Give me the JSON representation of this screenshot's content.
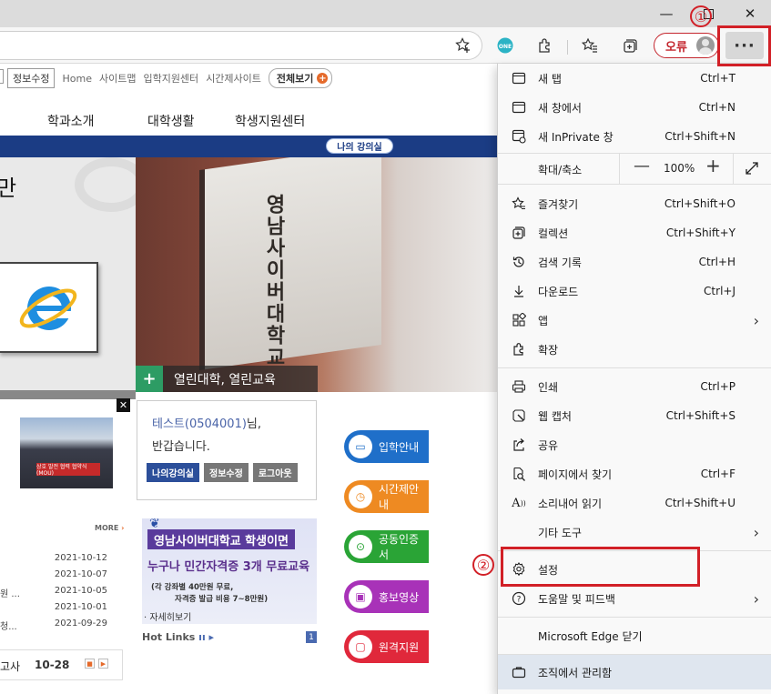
{
  "titlebar": {
    "minimize_icon": "minimize-icon",
    "maximize_icon": "maximize-icon",
    "close_icon": "close-icon"
  },
  "toolbar": {
    "error_label": "오류",
    "more_label": "···"
  },
  "annotations": {
    "marker1": "①",
    "marker2": "②",
    "highlight_color": "#d22027"
  },
  "page": {
    "top_links": {
      "profile_edit": "정보수정",
      "home": "Home",
      "sitemap": "사이트맵",
      "admission_center": "입학지원센터",
      "timetable_site": "시간제사이트",
      "view_all": "전체보기"
    },
    "gnb": [
      "학과소개",
      "대학생활",
      "학생지원센터"
    ],
    "my_lecture_badge": "나의 강의실",
    "hero_left_char": "만",
    "hero_sign_text": "영남사이버대학교",
    "hero_caption": "열린대학, 열린교육",
    "login_box": {
      "user": "테스트(0504001)",
      "greeting_suffix": "님,",
      "greeting_line2": "반갑습니다.",
      "buttons": [
        "나의강의실",
        "정보수정",
        "로그아웃"
      ]
    },
    "quick_menu": [
      {
        "label": "입학안내",
        "color": "#1f6fc9"
      },
      {
        "label": "시간제안내",
        "color": "#ee8a22"
      },
      {
        "label": "공동인증서",
        "color": "#2aa436"
      },
      {
        "label": "홍보영상",
        "color": "#a832b8"
      },
      {
        "label": "원격지원",
        "color": "#e0283b"
      }
    ],
    "ad_banner": {
      "line1": "영남사이버대학교 학생이면",
      "line2": "누구나 민간자격증 3개 무료교육",
      "line3": "(각 강좌별 40만원 무료,",
      "line4": "자격증 발급 비용 7~8만원)",
      "more": "· 자세히보기"
    },
    "hot_links": "Hot Links",
    "hot_links_page": "1",
    "more_label": "MORE",
    "news": [
      {
        "title": "",
        "date": "2021-10-12"
      },
      {
        "title": "",
        "date": "2021-10-07"
      },
      {
        "title": "원 ...",
        "date": "2021-10-05"
      },
      {
        "title": "",
        "date": "2021-10-01"
      },
      {
        "title": "청...",
        "date": "2021-09-29"
      }
    ],
    "exam_label": "고사",
    "exam_date": "10-28",
    "thumb_banner": "상호 발전 협력 협약식(MOU)"
  },
  "menu": {
    "items": [
      {
        "name": "new-tab",
        "icon": "new-tab-icon",
        "label": "새 탭",
        "shortcut": "Ctrl+T"
      },
      {
        "name": "new-window",
        "icon": "new-window-icon",
        "label": "새 창에서",
        "shortcut": "Ctrl+N"
      },
      {
        "name": "new-inprivate",
        "icon": "inprivate-icon",
        "label": "새 InPrivate 창",
        "shortcut": "Ctrl+Shift+N"
      },
      {
        "name": "favorites",
        "icon": "favorites-icon",
        "label": "즐겨찾기",
        "shortcut": "Ctrl+Shift+O"
      },
      {
        "name": "collections",
        "icon": "collections-icon",
        "label": "컬렉션",
        "shortcut": "Ctrl+Shift+Y"
      },
      {
        "name": "history",
        "icon": "history-icon",
        "label": "검색 기록",
        "shortcut": "Ctrl+H"
      },
      {
        "name": "downloads",
        "icon": "download-icon",
        "label": "다운로드",
        "shortcut": "Ctrl+J"
      },
      {
        "name": "apps",
        "icon": "apps-icon",
        "label": "앱",
        "shortcut": ""
      },
      {
        "name": "extensions",
        "icon": "extensions-icon",
        "label": "확장",
        "shortcut": ""
      },
      {
        "name": "print",
        "icon": "print-icon",
        "label": "인쇄",
        "shortcut": "Ctrl+P"
      },
      {
        "name": "web-capture",
        "icon": "web-capture-icon",
        "label": "웹 캡처",
        "shortcut": "Ctrl+Shift+S"
      },
      {
        "name": "share",
        "icon": "share-icon",
        "label": "공유",
        "shortcut": ""
      },
      {
        "name": "find",
        "icon": "find-icon",
        "label": "페이지에서 찾기",
        "shortcut": "Ctrl+F"
      },
      {
        "name": "read-aloud",
        "icon": "read-aloud-icon",
        "label": "소리내어 읽기",
        "shortcut": "Ctrl+Shift+U"
      },
      {
        "name": "more-tools",
        "icon": "",
        "label": "기타 도구",
        "shortcut": ""
      },
      {
        "name": "settings",
        "icon": "gear-icon",
        "label": "설정",
        "shortcut": ""
      },
      {
        "name": "help",
        "icon": "help-icon",
        "label": "도움말 및 피드백",
        "shortcut": ""
      },
      {
        "name": "close-edge",
        "icon": "",
        "label": "Microsoft Edge 닫기",
        "shortcut": ""
      },
      {
        "name": "managed",
        "icon": "briefcase-icon",
        "label": "조직에서 관리함",
        "shortcut": ""
      }
    ],
    "zoom": {
      "label": "확대/축소",
      "minus": "—",
      "value": "100%",
      "plus": "+"
    }
  }
}
